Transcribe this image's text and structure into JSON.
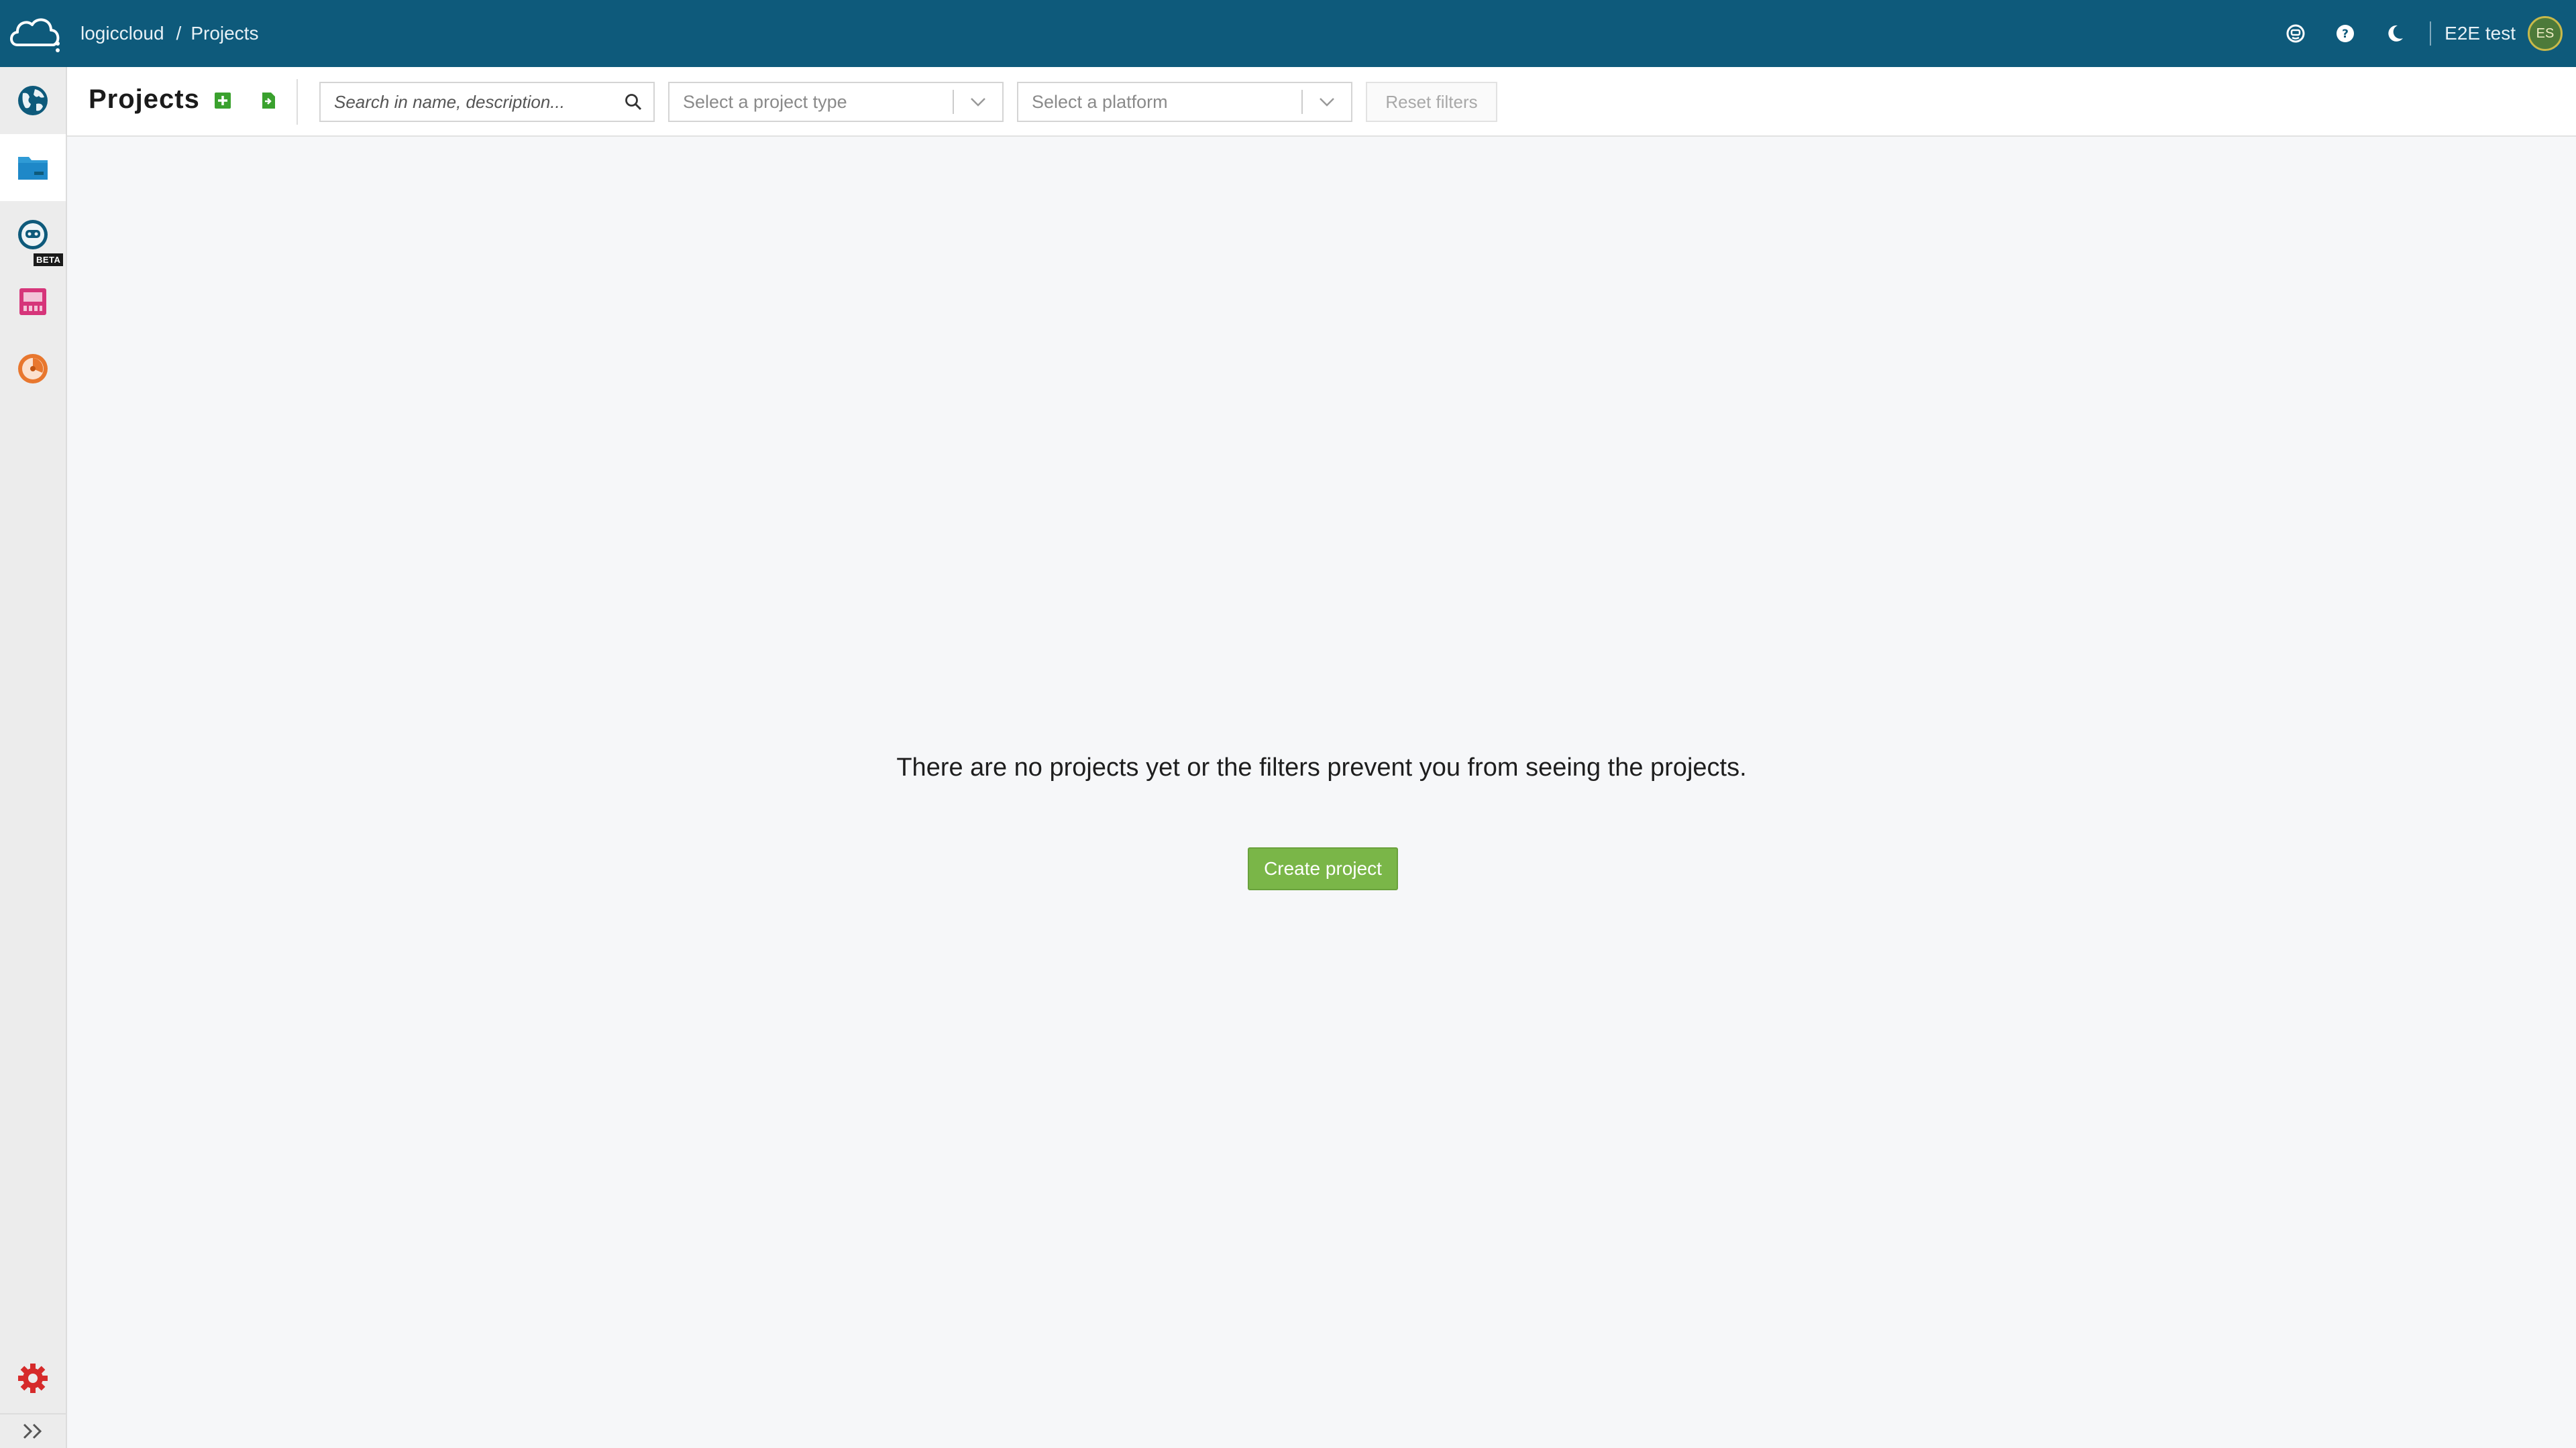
{
  "app": {
    "logo_icon": "cloud-logo-icon",
    "breadcrumb": {
      "root": "logiccloud",
      "separator": "/",
      "current": "Projects"
    }
  },
  "topbar": {
    "icons": [
      "feedback-smiley-icon",
      "help-icon",
      "dark-mode-moon-icon"
    ],
    "user_name": "E2E test",
    "avatar_initials": "ES"
  },
  "sidebar": {
    "items": [
      {
        "name": "globe-icon",
        "active": false
      },
      {
        "name": "projects-folder-icon",
        "active": true
      },
      {
        "name": "robot-icon",
        "active": false,
        "badge": "BETA"
      },
      {
        "name": "device-icon",
        "active": false
      },
      {
        "name": "monitoring-icon",
        "active": false
      }
    ],
    "bottom": [
      "settings-gear-icon",
      "expand-chevrons-icon"
    ]
  },
  "header": {
    "title": "Projects",
    "add_icon": "add-project-icon",
    "import_icon": "import-project-icon",
    "search_placeholder": "Search in name, description...",
    "project_type_placeholder": "Select a project type",
    "platform_placeholder": "Select a platform",
    "reset_label": "Reset filters"
  },
  "main": {
    "empty_message": "There are no projects yet or the filters prevent you from seeing the projects.",
    "create_label": "Create project"
  },
  "colors": {
    "topbar": "#0e5a7b",
    "accent_green": "#7ab648",
    "folder_blue": "#2f9bd6",
    "settings_red": "#d62b2b"
  }
}
